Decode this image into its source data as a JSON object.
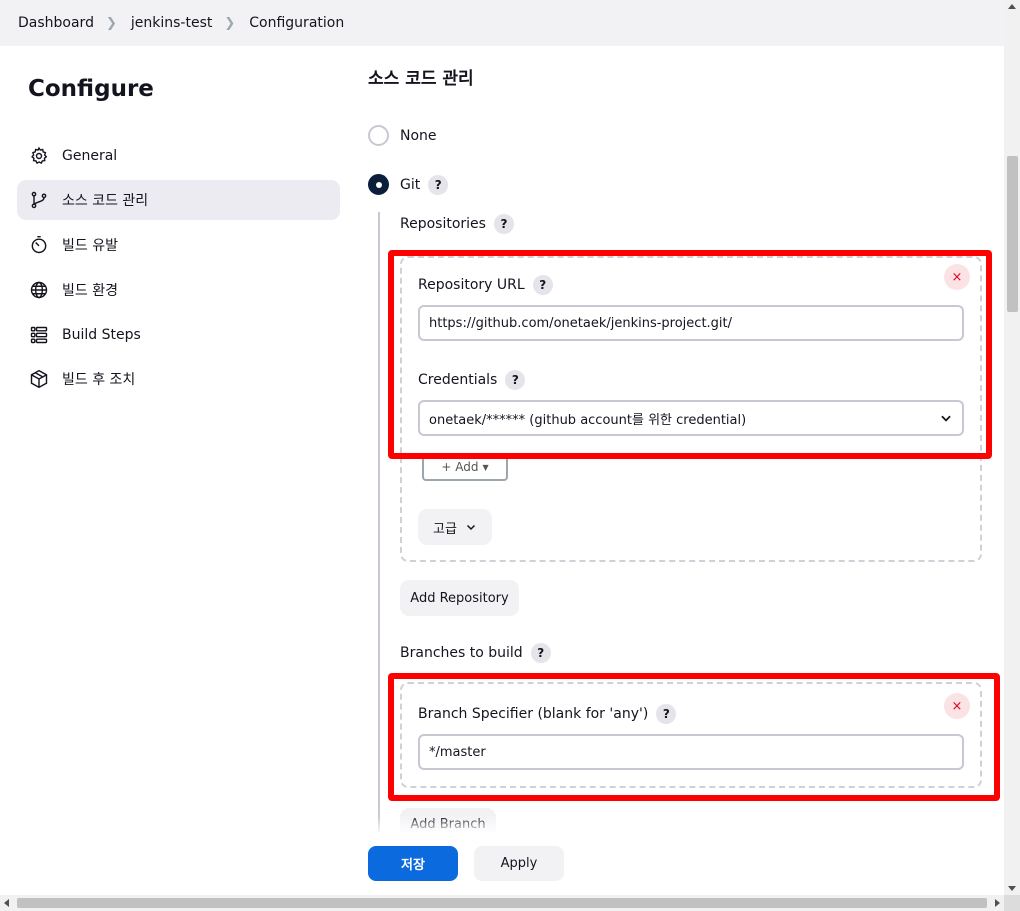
{
  "breadcrumb": {
    "items": [
      "Dashboard",
      "jenkins-test",
      "Configuration"
    ]
  },
  "sidebar": {
    "title": "Configure",
    "items": [
      {
        "label": "General",
        "icon": "gear-icon"
      },
      {
        "label": "소스 코드 관리",
        "icon": "git-branch-icon"
      },
      {
        "label": "빌드 유발",
        "icon": "timer-icon"
      },
      {
        "label": "빌드 환경",
        "icon": "globe-icon"
      },
      {
        "label": "Build Steps",
        "icon": "list-icon"
      },
      {
        "label": "빌드 후 조치",
        "icon": "package-icon"
      }
    ]
  },
  "main": {
    "section_title": "소스 코드 관리",
    "scm_options": {
      "none": "None",
      "git": "Git"
    },
    "help_glyph": "?",
    "repositories": {
      "label": "Repositories",
      "repo_url_label": "Repository URL",
      "repo_url_value": "https://github.com/onetaek/jenkins-project.git/",
      "credentials_label": "Credentials",
      "credentials_value": "onetaek/****** (github account를 위한 credential)",
      "add_button": "+ Add",
      "advanced_button": "고급",
      "add_repository_button": "Add Repository",
      "close_glyph": "×"
    },
    "branches": {
      "label": "Branches to build",
      "specifier_label": "Branch Specifier (blank for 'any')",
      "specifier_value": "*/master",
      "add_branch_button": "Add Branch",
      "close_glyph": "×"
    }
  },
  "footer": {
    "save": "저장",
    "apply": "Apply"
  },
  "colors": {
    "accent": "#0b6bde",
    "highlight_box": "#ff0000",
    "dark_radio": "#0b1f3a",
    "danger": "#e6001f"
  }
}
